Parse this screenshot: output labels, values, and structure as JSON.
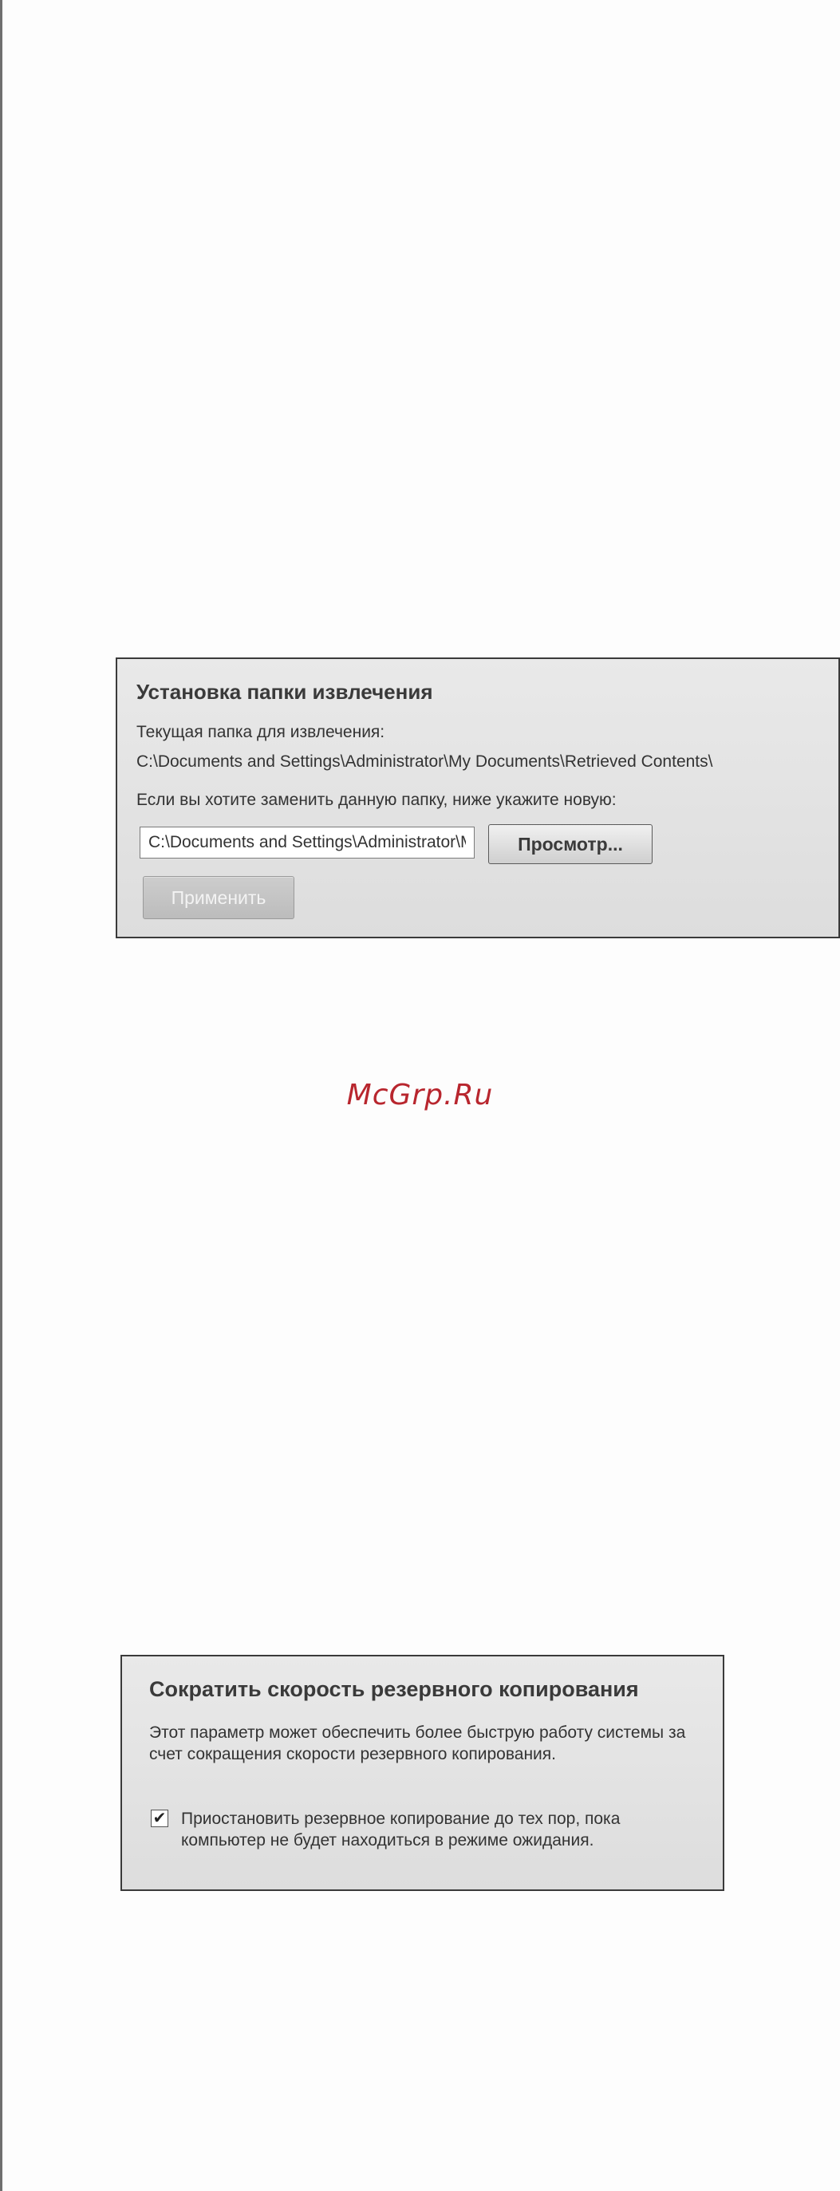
{
  "extract_panel": {
    "title": "Установка папки извлечения",
    "current_label": "Текущая папка для извлечения:",
    "current_path": "C:\\Documents and Settings\\Administrator\\My Documents\\Retrieved Contents\\",
    "change_instruction": "Если вы хотите заменить данную папку, ниже укажите новую:",
    "new_path_value": "C:\\Documents and Settings\\Administrator\\My Documents\\Retrieved Contents\\",
    "browse_label": "Просмотр...",
    "apply_label": "Применить"
  },
  "watermark": "McGrp.Ru",
  "backup_panel": {
    "title": "Сократить скорость резервного копирования",
    "description": "Этот параметр может обеспечить более быструю работу системы за счет сокращения скорости резервного копирования.",
    "checkbox_checked": true,
    "checkbox_mark": "✔",
    "checkbox_label": "Приостановить резервное копирование до тех пор, пока компьютер не будет находиться в режиме ожидания."
  }
}
